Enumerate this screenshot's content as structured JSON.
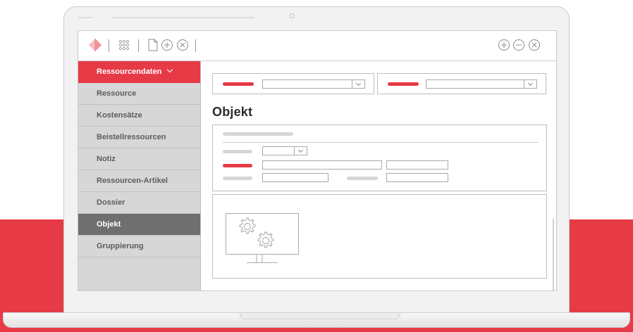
{
  "colors": {
    "accent": "#e63a46",
    "sidebar_active": "#6f6f6f",
    "sidebar_bg": "#d7d7d7"
  },
  "toolbar": {
    "left_icons": [
      "logo-icon",
      "grid-icon",
      "document-icon",
      "plus-circle-icon",
      "x-circle-icon"
    ],
    "right_icons": [
      "plus-circle-icon",
      "minus-circle-icon",
      "x-circle-icon"
    ]
  },
  "sidebar": {
    "header": "Ressourcendaten",
    "items": [
      {
        "label": "Ressource"
      },
      {
        "label": "Kostensätze"
      },
      {
        "label": "Beistellressourcen"
      },
      {
        "label": "Notiz"
      },
      {
        "label": "Ressourcen-Artikel"
      },
      {
        "label": "Dossier"
      },
      {
        "label": "Objekt",
        "active": true
      },
      {
        "label": "Gruppierung"
      }
    ]
  },
  "main": {
    "title": "Objekt",
    "image_placeholder_icon": "gears-monitor-icon"
  }
}
